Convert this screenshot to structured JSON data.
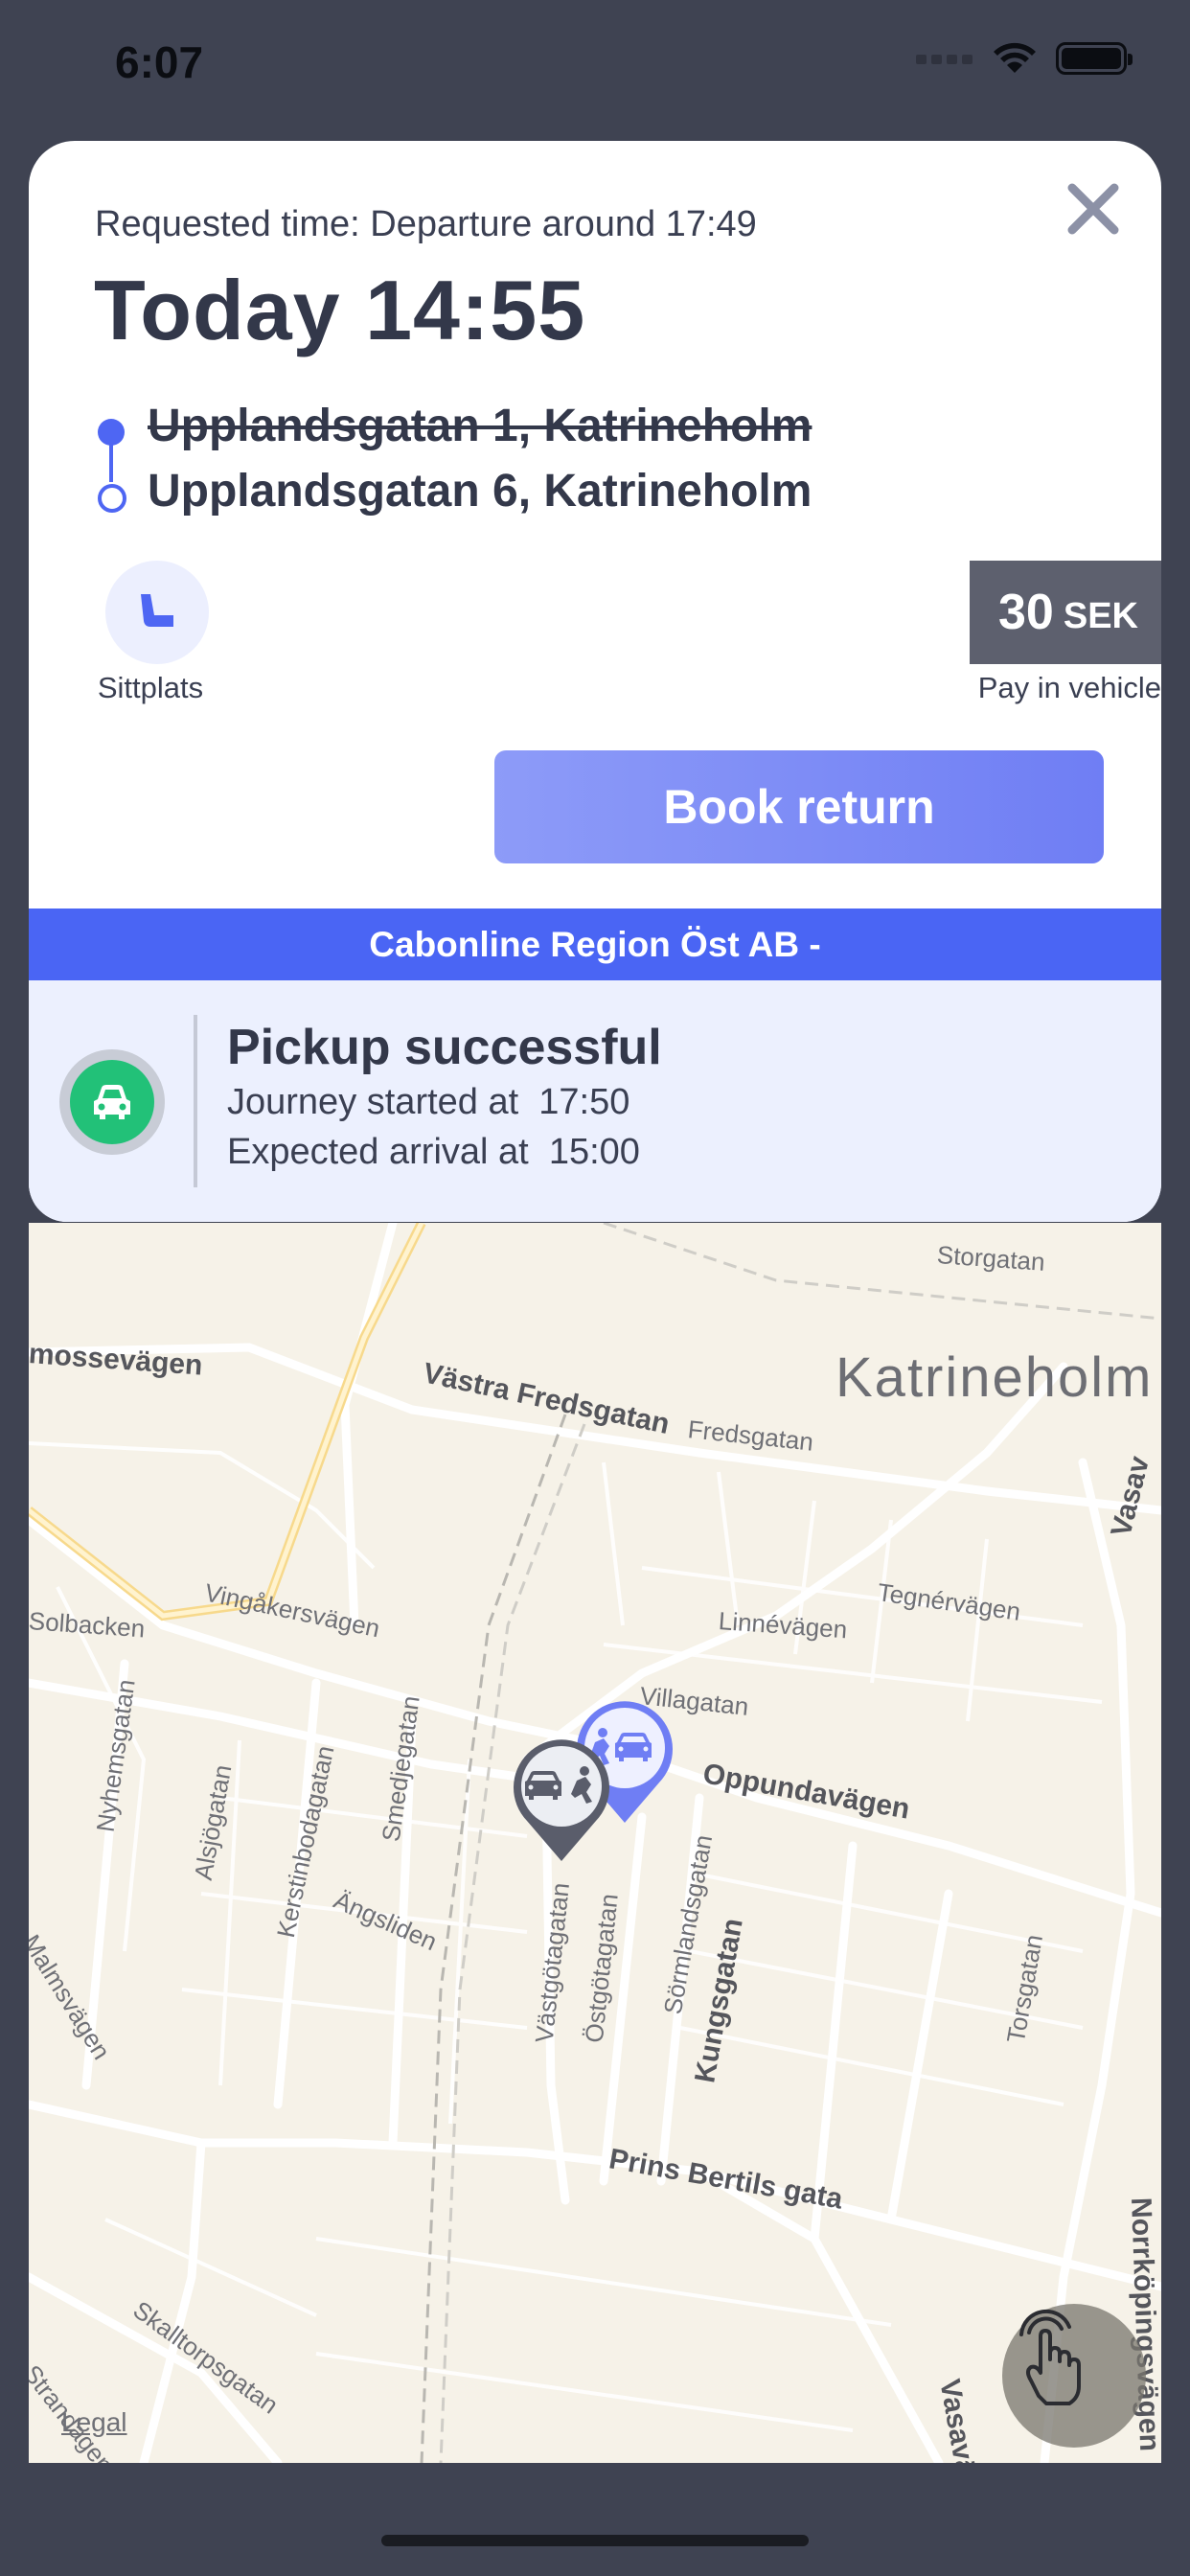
{
  "status_bar": {
    "time": "6:07"
  },
  "booking": {
    "requested_time": "Requested time: Departure around 17:49",
    "date_time": "Today 14:55",
    "from": "Upplandsgatan 1, Katrineholm",
    "to": "Upplandsgatan 6, Katrineholm",
    "seat_label": "Sittplats",
    "price_amount": "30",
    "price_currency": "SEK",
    "payment_label": "Pay in vehicle",
    "book_return_label": "Book return",
    "operator": "Cabonline Region Öst AB  -"
  },
  "trip_status": {
    "title": "Pickup successful",
    "journey_started": "Journey started at  17:50",
    "expected_arrival": "Expected arrival at  15:00"
  },
  "map": {
    "city": "Katrineholm",
    "streets": {
      "storgatan": "Storgatan",
      "mossevagen": "mossevägen",
      "vastra_fredsgatan": "Västra Fredsgatan",
      "fredsgatan": "Fredsgatan",
      "vasa_top": "Vasav",
      "tegnervagen": "Tegnérvägen",
      "linnevagen": "Linnévägen",
      "vingakersvagen": "Vingåkersvägen",
      "solbacken": "Solbacken",
      "villagatan": "Villagatan",
      "oppundavagen": "Oppundavägen",
      "nyhemsgatan": "Nyhemsgatan",
      "alsjogatan": "Alsjögatan",
      "kerstinbodagatan": "Kerstinbodagatan",
      "smedjegatan": "Smedjegatan",
      "angsliden": "Ängsliden",
      "malmsvagen": "Malmsvägen",
      "vastgotagatan": "Västgötagatan",
      "ostgotagatan": "Östgötagatan",
      "sormlandsgatan": "Sörmlandsgatan",
      "kungsgatan": "Kungsgatan",
      "torsgatan": "Torsgatan",
      "prins_bertils_gata": "Prins Bertils gata",
      "norrkopingsvagen": "Norrköpingsvägen",
      "skalltorpsgatan": "Skalltorpsgatan",
      "strandagen": "Strandagen",
      "vasavag": "Vasaväg"
    },
    "legal": "Legal"
  },
  "colors": {
    "accent": "#4a65f4",
    "success": "#22c178",
    "price_bg": "#5d606e",
    "pickup_pin": "#6f7ef4",
    "vehicle_pin": "#5a5d6b"
  },
  "icons": {
    "close": "close-icon",
    "seat": "seat-icon",
    "car": "car-icon",
    "gesture": "hand-tap-icon"
  }
}
